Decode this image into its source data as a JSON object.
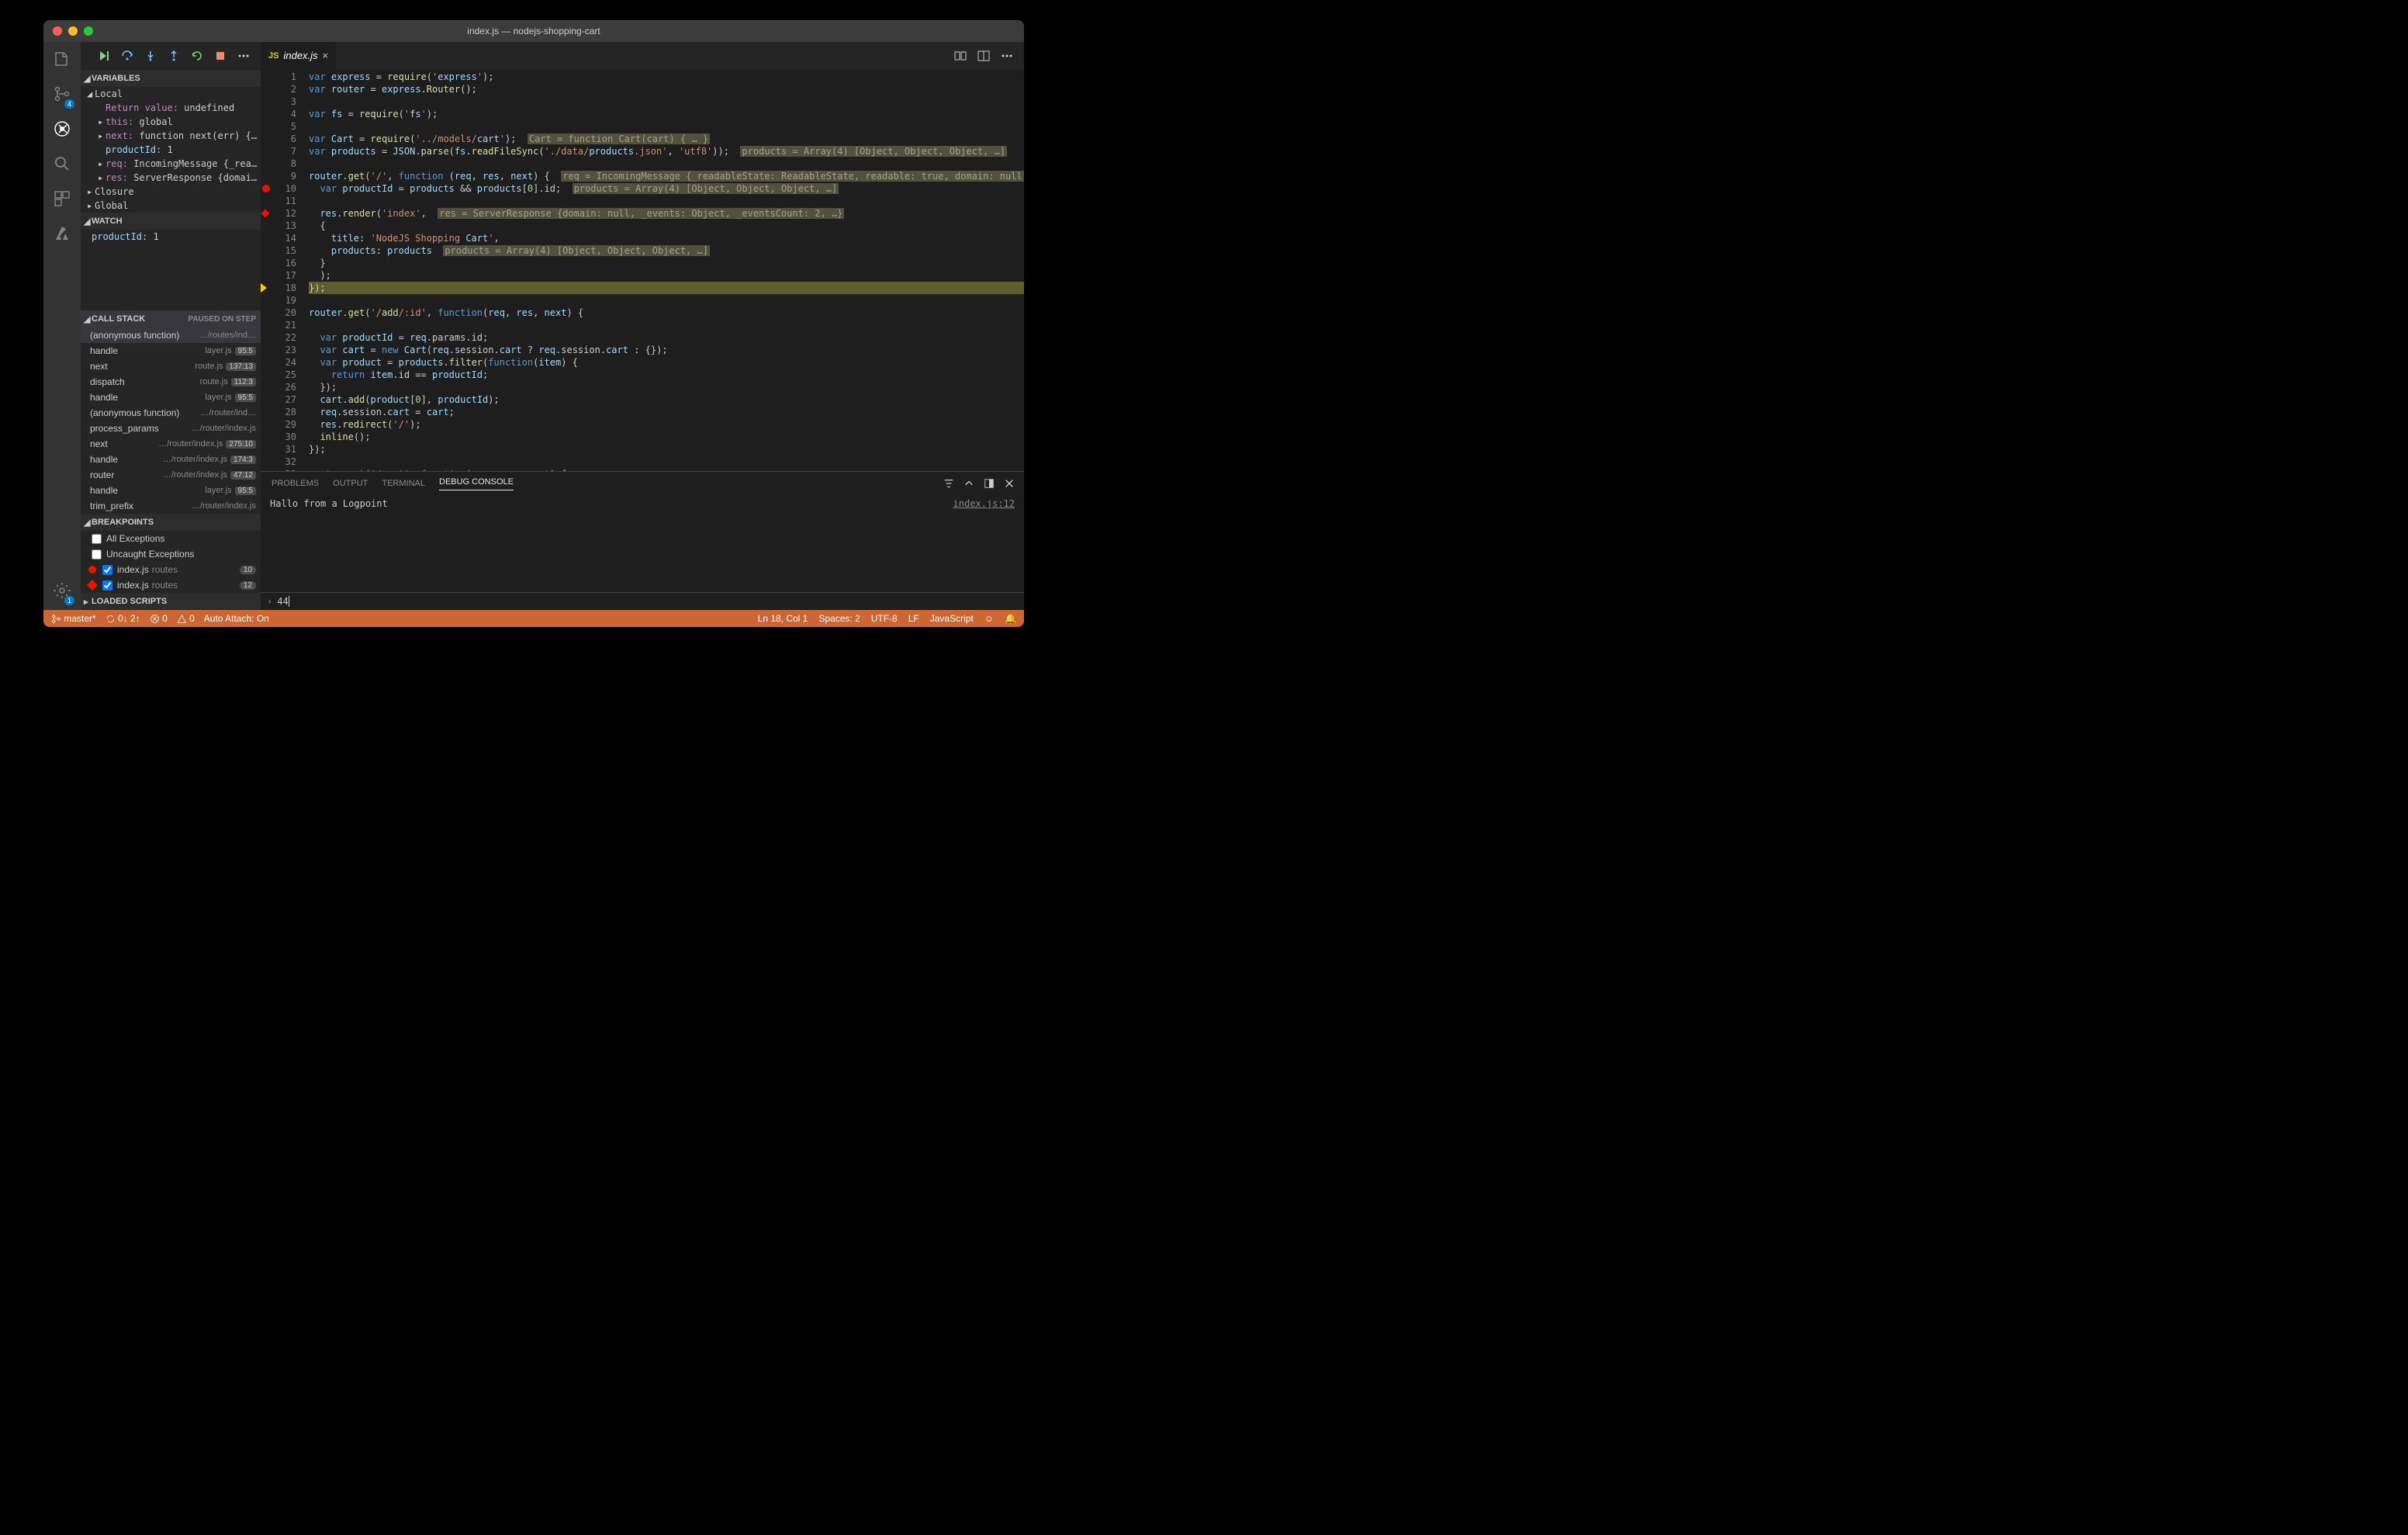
{
  "window": {
    "title": "index.js — nodejs-shopping-cart"
  },
  "activity": {
    "scm_badge": "4",
    "gear_badge": "1"
  },
  "debug_sections": {
    "variables": "VARIABLES",
    "watch": "WATCH",
    "callstack": "CALL STACK",
    "callstack_status": "PAUSED ON STEP",
    "breakpoints": "BREAKPOINTS",
    "loaded": "LOADED SCRIPTS"
  },
  "variables": {
    "scopes": {
      "local": "Local",
      "closure": "Closure",
      "global": "Global"
    },
    "local": [
      {
        "key": "Return value",
        "val": "undefined",
        "keyClass": "key"
      },
      {
        "key": "this",
        "val": "global",
        "keyClass": "key",
        "chev": "▸"
      },
      {
        "key": "next",
        "val": "function next(err) { … }",
        "keyClass": "key",
        "chev": "▸"
      },
      {
        "key": "productId",
        "val": "1",
        "keyClass": "key2"
      },
      {
        "key": "req",
        "val": "IncomingMessage {_readableSt…",
        "keyClass": "key",
        "chev": "▸"
      },
      {
        "key": "res",
        "val": "ServerResponse {domain: null…",
        "keyClass": "key",
        "chev": "▸"
      }
    ]
  },
  "watch": [
    {
      "key": "productId",
      "val": "1"
    }
  ],
  "callstack": [
    {
      "fn": "(anonymous function)",
      "file": "…/routes/ind…",
      "sel": true
    },
    {
      "fn": "handle",
      "file": "layer.js",
      "pos": "95:5"
    },
    {
      "fn": "next",
      "file": "route.js",
      "pos": "137:13"
    },
    {
      "fn": "dispatch",
      "file": "route.js",
      "pos": "112:3"
    },
    {
      "fn": "handle",
      "file": "layer.js",
      "pos": "95:5"
    },
    {
      "fn": "(anonymous function)",
      "file": "…/router/ind…"
    },
    {
      "fn": "process_params",
      "file": "…/router/index.js"
    },
    {
      "fn": "next",
      "file": "…/router/index.js",
      "pos": "275:10"
    },
    {
      "fn": "handle",
      "file": "…/router/index.js",
      "pos": "174:3"
    },
    {
      "fn": "router",
      "file": "…/router/index.js",
      "pos": "47:12"
    },
    {
      "fn": "handle",
      "file": "layer.js",
      "pos": "95:5"
    },
    {
      "fn": "trim_prefix",
      "file": "…/router/index.js"
    }
  ],
  "breakpoints": {
    "all_ex": "All Exceptions",
    "uncaught_ex": "Uncaught Exceptions",
    "items": [
      {
        "file": "index.js",
        "folder": "routes",
        "line": "10",
        "shape": "dot"
      },
      {
        "file": "index.js",
        "folder": "routes",
        "line": "12",
        "shape": "diamond"
      }
    ]
  },
  "tab": {
    "label": "index.js"
  },
  "editor_lines": [
    "var express = require('express');",
    "var router = express.Router();",
    "",
    "var fs = require('fs');",
    "",
    "var Cart = require('../models/cart');",
    "var products = JSON.parse(fs.readFileSync('./data/products.json', 'utf8'));",
    "",
    "router.get('/', function (req, res, next) {",
    "  var productId = products && products[0].id;",
    "",
    "  res.render('index',",
    "  {",
    "    title: 'NodeJS Shopping Cart',",
    "    products: products",
    "  }",
    "  );",
    "});",
    "",
    "router.get('/add/:id', function(req, res, next) {",
    "",
    "  var productId = req.params.id;",
    "  var cart = new Cart(req.session.cart ? req.session.cart : {});",
    "  var product = products.filter(function(item) {",
    "    return item.id == productId;",
    "  });",
    "  cart.add(product[0], productId);",
    "  req.session.cart = cart;",
    "  res.redirect('/');",
    "  inline();",
    "});",
    "",
    "router.get('/cart', function(req, res, next) {"
  ],
  "inline_hints": {
    "6": "Cart = function Cart(cart) { … }",
    "7": "products = Array(4) [Object, Object, Object, …]",
    "9": "req = IncomingMessage {_readableState: ReadableState, readable: true, domain: null, …}, res = ServerRes…",
    "10": "products = Array(4) [Object, Object, Object, …]",
    "12": "res = ServerResponse {domain: null, _events: Object, _eventsCount: 2, …}",
    "15": "products = Array(4) [Object, Object, Object, …]"
  },
  "gutter": {
    "bp": 10,
    "bpd": 12,
    "cur": 18,
    "total": 33
  },
  "panel": {
    "tabs": {
      "problems": "PROBLEMS",
      "output": "OUTPUT",
      "terminal": "TERMINAL",
      "debug": "DEBUG CONSOLE"
    },
    "log": "Hallo from a Logpoint",
    "src": "index.js:12",
    "repl": "44"
  },
  "status": {
    "branch": "master*",
    "sync": "0↓ 2↑",
    "errors": "0",
    "warnings": "0",
    "auto_attach": "Auto Attach: On",
    "pos": "Ln 18, Col 1",
    "spaces": "Spaces: 2",
    "enc": "UTF-8",
    "eol": "LF",
    "lang": "JavaScript"
  }
}
